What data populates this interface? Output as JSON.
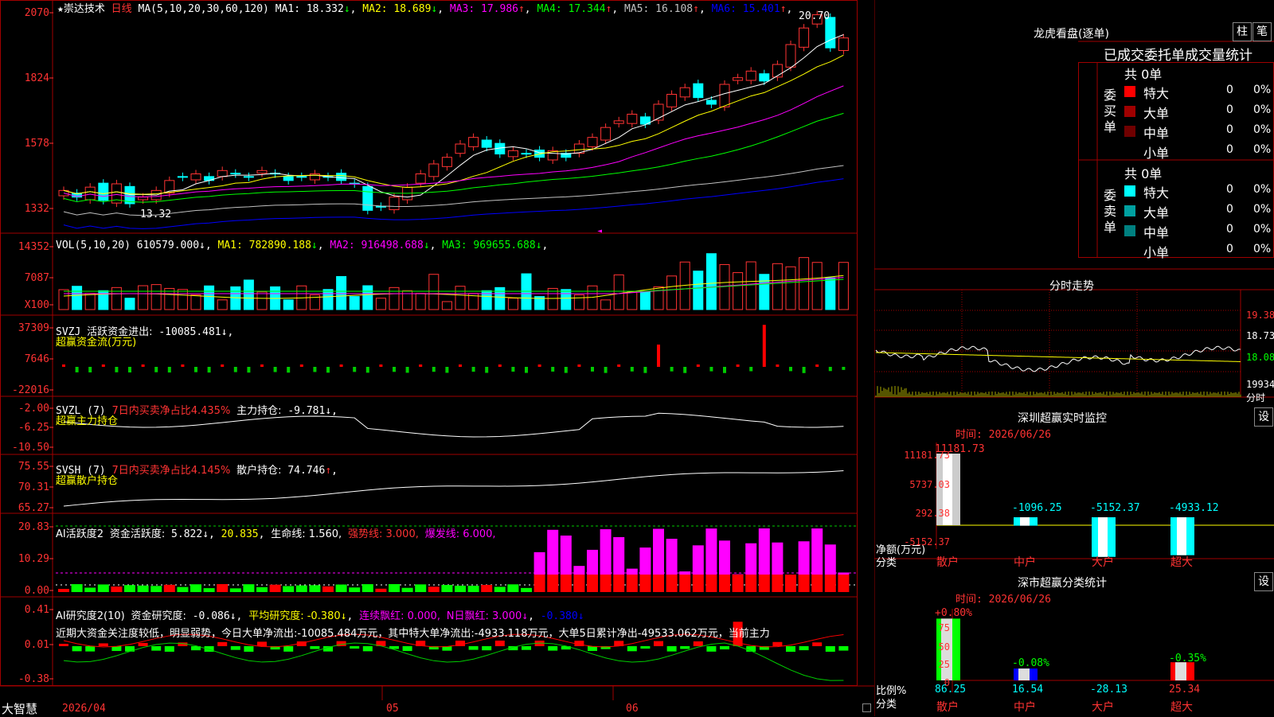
{
  "stock": {
    "name": "崇达技术",
    "period": "日线",
    "star": "★"
  },
  "ma_header": {
    "label": "MA(5,10,20,30,60,120)",
    "items": [
      {
        "text": "MA1: 18.332",
        "arrow": "↓",
        "color": "#ffffff"
      },
      {
        "text": "MA2: 18.689",
        "arrow": "↓",
        "color": "#ffff00"
      },
      {
        "text": "MA3: 17.986",
        "arrow": "↑",
        "color": "#ff00ff"
      },
      {
        "text": "MA4: 17.344",
        "arrow": "↑",
        "color": "#00ff00"
      },
      {
        "text": "MA5: 16.108",
        "arrow": "↑",
        "color": "#c0c0c0"
      },
      {
        "text": "MA6: 15.401",
        "arrow": "↑",
        "color": "#0000ff"
      }
    ],
    "high_label": "20.70",
    "low_label": "13.32"
  },
  "price_axis": [
    "2070",
    "1824",
    "1578",
    "1332"
  ],
  "vol_header": {
    "label": "VOL(5,10,20)",
    "value": "610579.000",
    "arrow": "↓",
    "items": [
      {
        "text": "MA1: 782890.188",
        "arrow": "↓",
        "color": "#ffff00"
      },
      {
        "text": "MA2: 916498.688",
        "arrow": "↓",
        "color": "#ff00ff"
      },
      {
        "text": "MA3: 969655.688",
        "arrow": "↓",
        "color": "#00ff00"
      }
    ]
  },
  "vol_axis": [
    "14352",
    "7087",
    "X100"
  ],
  "svzj": {
    "label": "SVZJ",
    "title": "活跃资金进出:",
    "value": "-10085.481",
    "arrow": "↓",
    "sub": "超赢资金流(万元)",
    "axis": [
      "37309",
      "7646",
      "-22016"
    ]
  },
  "svzl": {
    "label": "SVZL (7)",
    "title": "7日内买卖净占比4.435%",
    "title2": "主力持仓:",
    "value": "-9.781",
    "arrow": "↓",
    "sub": "超赢主力持仓",
    "axis": [
      "-2.00",
      "-6.25",
      "-10.50"
    ]
  },
  "svsh": {
    "label": "SVSH (7)",
    "title": "7日内买卖净占比4.145%",
    "title2": "散户持仓:",
    "value": "74.746",
    "arrow": "↑",
    "sub": "超赢散户持仓",
    "axis": [
      "75.55",
      "70.31",
      "65.27"
    ]
  },
  "ai_active": {
    "label": "AI活跃度2",
    "title": "资金活跃度:",
    "value": "5.822",
    "arrow": "↓",
    "v2": "20.835",
    "life": "生命线: 1.560,",
    "strong": "强势线: 3.000,",
    "burst": "爆发线: 6.000,",
    "axis": [
      "20.83",
      "10.29",
      "0.00"
    ]
  },
  "ai_research": {
    "label": "AI研究度2(10)",
    "title": "资金研究度:",
    "value": "-0.086",
    "arrow": "↓",
    "avg": "平均研究度: -0.380",
    "avg_arrow": "↓",
    "red": "连续飘红: 0.000,",
    "nred": "N日飘红: 3.000",
    "nred_arrow": "↓",
    "last": "-0.380",
    "last_arrow": "↓",
    "text": "近期大资金关注度较低，明显弱势，今日大单净流出:-10085.484万元，其中特大单净流出:-4933.118万元，大单5日累计净出-49533.062万元，当前主力",
    "axis": [
      "0.41",
      "0.01",
      "-0.38"
    ]
  },
  "bottom_bar": {
    "brand": "大智慧",
    "dates": [
      "2026/04",
      "05",
      "06"
    ]
  },
  "dragon": {
    "title": "龙虎看盘(逐单)",
    "btn1": "柱",
    "btn2": "笔",
    "tabs": "已成交委托单成交量统计",
    "buy_label": "委买单",
    "sell_label": "委卖单",
    "buy_total": "共 0单",
    "sell_total": "共 0单",
    "buy_rows": [
      {
        "name": "特大",
        "count": "0",
        "pct": "0%",
        "color": "#ff0000"
      },
      {
        "name": "大单",
        "count": "0",
        "pct": "0%",
        "color": "#a00000"
      },
      {
        "name": "中单",
        "count": "0",
        "pct": "0%",
        "color": "#700000"
      },
      {
        "name": "小单",
        "count": "0",
        "pct": "0%",
        "color": ""
      }
    ],
    "sell_rows": [
      {
        "name": "特大",
        "count": "0",
        "pct": "0%",
        "color": "#00ffff"
      },
      {
        "name": "大单",
        "count": "0",
        "pct": "0%",
        "color": "#00a0a0"
      },
      {
        "name": "中单",
        "count": "0",
        "pct": "0%",
        "color": "#008080"
      },
      {
        "name": "小单",
        "count": "0",
        "pct": "0%",
        "color": ""
      }
    ]
  },
  "intraday": {
    "title": "分时走势",
    "axis": [
      "19.38",
      "18.73",
      "18.08",
      "19934",
      "分时"
    ]
  },
  "sz_monitor": {
    "title": "深圳超赢实时监控",
    "settings": "设",
    "time_label": "时间: 2026/06/26",
    "axis": [
      "11181.73",
      "5737.03",
      "292.38",
      "-5152.37"
    ],
    "unit": "净额(万元)",
    "cat_label": "分类",
    "bars": [
      {
        "name": "散户",
        "value": "11181.73"
      },
      {
        "name": "中户",
        "value": "-1096.25"
      },
      {
        "name": "大户",
        "value": "-5152.37"
      },
      {
        "name": "超大",
        "value": "-4933.12"
      }
    ]
  },
  "sz_stats": {
    "title": "深市超赢分类统计",
    "settings": "设",
    "time_label": "时间: 2026/06/26",
    "axis": [
      "75",
      "50",
      "25",
      "0"
    ],
    "unit": "比例%",
    "cat_label": "分类",
    "bars": [
      {
        "name": "散户",
        "top": "+0.80%",
        "value": "86.25"
      },
      {
        "name": "中户",
        "top": "-0.08%",
        "value": "16.54"
      },
      {
        "name": "大户",
        "top": "",
        "value": "-28.13"
      },
      {
        "name": "超大",
        "top": "-0.35%",
        "value": "25.34"
      }
    ]
  },
  "colors": {
    "up": "#ff3333",
    "down": "#00ffff",
    "grid": "#a00000",
    "axis_text": "#ff3333"
  }
}
